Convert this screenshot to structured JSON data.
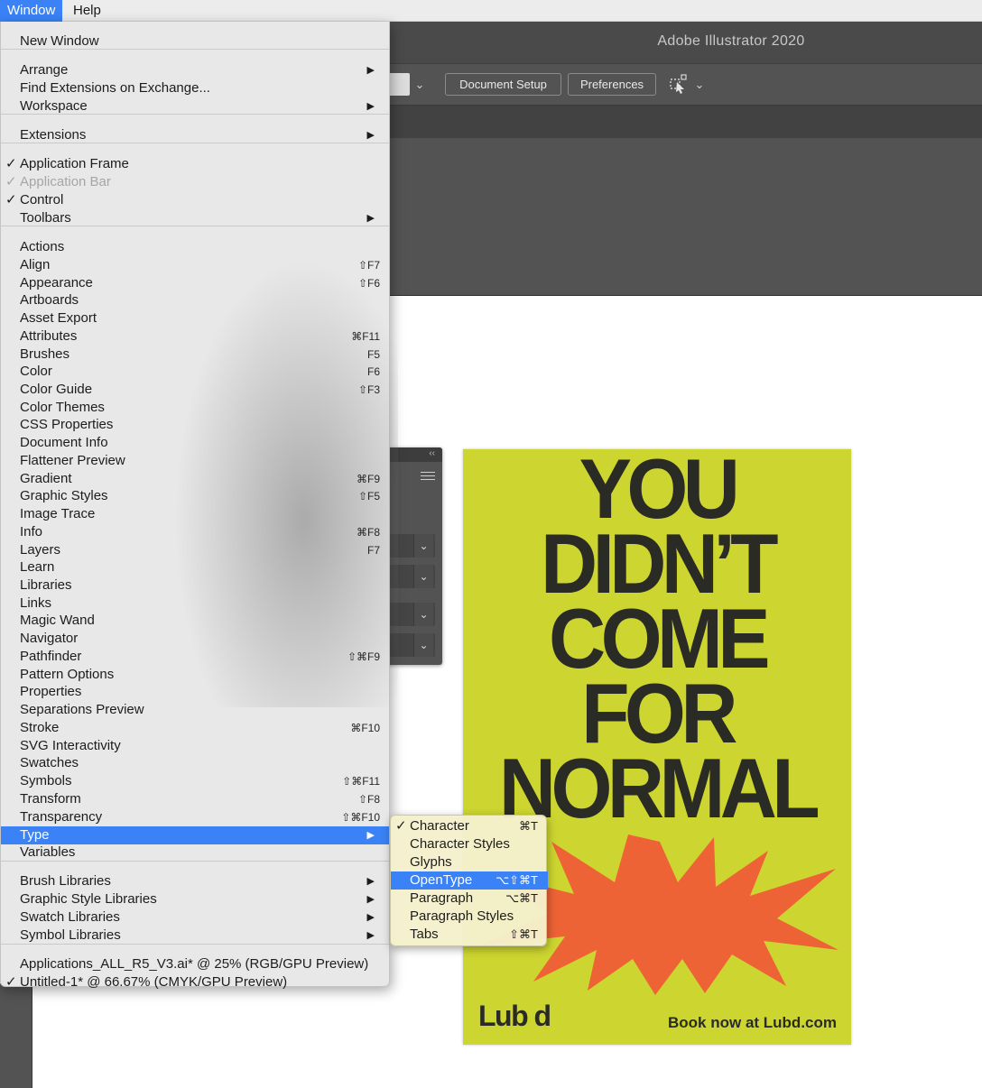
{
  "menubar": {
    "items": [
      "Window",
      "Help"
    ]
  },
  "app": {
    "title": "Adobe Illustrator 2020"
  },
  "control": {
    "document_setup": "Document Setup",
    "preferences": "Preferences"
  },
  "poster": {
    "headline": [
      "YOU",
      "DIDN’T",
      "COME",
      "FOR",
      "NORMAL"
    ],
    "brand": "Lub d",
    "cta": "Book now at Lubd.com",
    "background_color": "#cdd630",
    "burst_color": "#ee6335"
  },
  "window_menu": {
    "items": [
      {
        "label": "New Window"
      },
      {
        "label": "Arrange",
        "submenu": true
      },
      {
        "label": "Find Extensions on Exchange..."
      },
      {
        "label": "Workspace",
        "submenu": true
      },
      {
        "label": "Extensions",
        "submenu": true
      },
      {
        "label": "Application Frame",
        "checked": true
      },
      {
        "label": "Application Bar",
        "checked": true,
        "disabled": true
      },
      {
        "label": "Control",
        "checked": true
      },
      {
        "label": "Toolbars",
        "submenu": true
      },
      {
        "label": "Actions"
      },
      {
        "label": "Align",
        "shortcut": "⇧F7"
      },
      {
        "label": "Appearance",
        "shortcut": "⇧F6"
      },
      {
        "label": "Artboards"
      },
      {
        "label": "Asset Export"
      },
      {
        "label": "Attributes",
        "shortcut": "⌘F11"
      },
      {
        "label": "Brushes",
        "shortcut": "F5"
      },
      {
        "label": "Color",
        "shortcut": "F6"
      },
      {
        "label": "Color Guide",
        "shortcut": "⇧F3"
      },
      {
        "label": "Color Themes"
      },
      {
        "label": "CSS Properties"
      },
      {
        "label": "Document Info"
      },
      {
        "label": "Flattener Preview"
      },
      {
        "label": "Gradient",
        "shortcut": "⌘F9"
      },
      {
        "label": "Graphic Styles",
        "shortcut": "⇧F5"
      },
      {
        "label": "Image Trace"
      },
      {
        "label": "Info",
        "shortcut": "⌘F8"
      },
      {
        "label": "Layers",
        "shortcut": "F7"
      },
      {
        "label": "Learn"
      },
      {
        "label": "Libraries"
      },
      {
        "label": "Links"
      },
      {
        "label": "Magic Wand"
      },
      {
        "label": "Navigator"
      },
      {
        "label": "Pathfinder",
        "shortcut": "⇧⌘F9"
      },
      {
        "label": "Pattern Options"
      },
      {
        "label": "Properties"
      },
      {
        "label": "Separations Preview"
      },
      {
        "label": "Stroke",
        "shortcut": "⌘F10"
      },
      {
        "label": "SVG Interactivity"
      },
      {
        "label": "Swatches"
      },
      {
        "label": "Symbols",
        "shortcut": "⇧⌘F11"
      },
      {
        "label": "Transform",
        "shortcut": "⇧F8"
      },
      {
        "label": "Transparency",
        "shortcut": "⇧⌘F10"
      },
      {
        "label": "Type",
        "submenu": true,
        "highlighted": true
      },
      {
        "label": "Variables"
      },
      {
        "label": "Brush Libraries",
        "submenu": true
      },
      {
        "label": "Graphic Style Libraries",
        "submenu": true
      },
      {
        "label": "Swatch Libraries",
        "submenu": true
      },
      {
        "label": "Symbol Libraries",
        "submenu": true
      },
      {
        "label": "Applications_ALL_R5_V3.ai* @ 25% (RGB/GPU Preview)"
      },
      {
        "label": "Untitled-1* @ 66.67% (CMYK/GPU Preview)",
        "checked": true
      }
    ]
  },
  "type_submenu": {
    "items": [
      {
        "label": "Character",
        "shortcut": "⌘T",
        "checked": true
      },
      {
        "label": "Character Styles"
      },
      {
        "label": "Glyphs"
      },
      {
        "label": "OpenType",
        "shortcut": "⌥⇧⌘T",
        "highlighted": true
      },
      {
        "label": "Paragraph",
        "shortcut": "⌥⌘T"
      },
      {
        "label": "Paragraph Styles"
      },
      {
        "label": "Tabs",
        "shortcut": "⇧⌘T"
      }
    ]
  },
  "glyphs": {
    "check": "✓",
    "arrow": "▶",
    "chevron": "⌄",
    "collapse": "‹‹"
  }
}
